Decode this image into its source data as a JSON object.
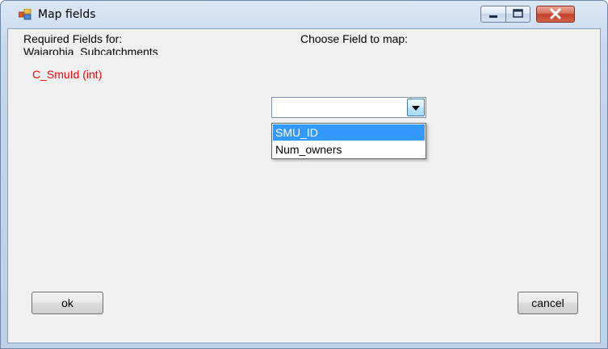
{
  "window": {
    "title": "Map fields",
    "icon": "form-app-icon",
    "controls": {
      "minimize": "minimize-icon",
      "maximize": "maximize-icon",
      "close": "close-icon"
    }
  },
  "form": {
    "required_label": "Required Fields for:",
    "layer_name": "Waiarohia_Subcatchments",
    "choose_label": "Choose Field to map:",
    "fields": [
      {
        "label": "C_SmuId (int)",
        "color": "#ff0000"
      }
    ]
  },
  "combo": {
    "value": "",
    "options": [
      "SMU_ID",
      "Num_owners"
    ],
    "highlighted": "SMU_ID"
  },
  "buttons": {
    "ok": "ok",
    "cancel": "cancel"
  },
  "colors": {
    "highlight": "#3399ff",
    "required_field": "#ff0000",
    "close_button": "#c2402a"
  }
}
